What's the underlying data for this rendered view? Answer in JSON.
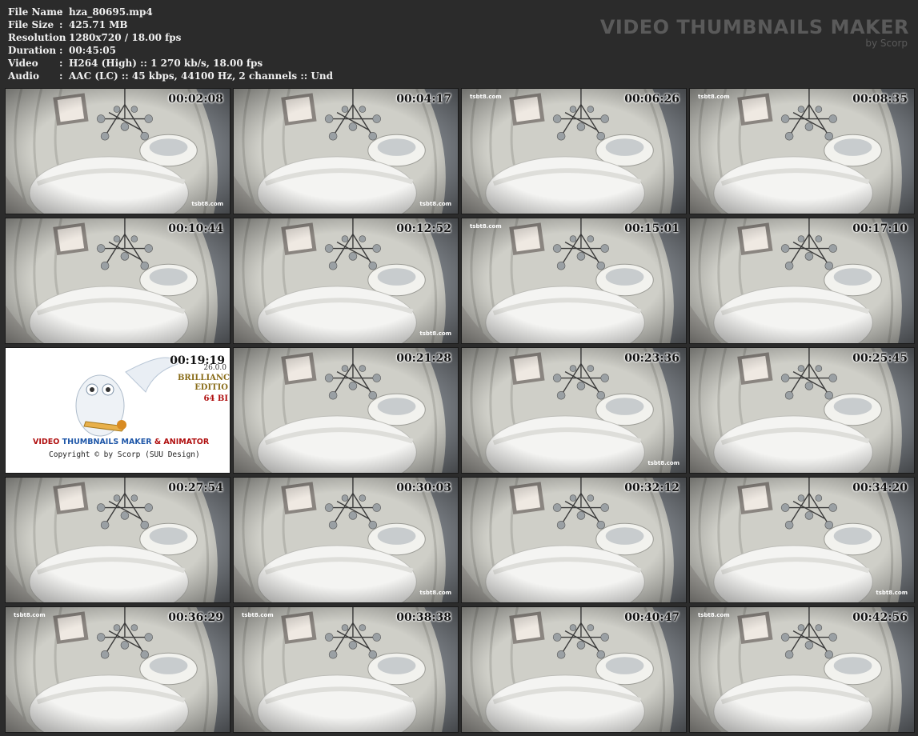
{
  "file_info": [
    {
      "key": "File Name",
      "value": "hza_80695.mp4"
    },
    {
      "key": "File Size",
      "value": "425.71 MB"
    },
    {
      "key": "Resolution",
      "value": "1280x720 / 18.00 fps"
    },
    {
      "key": "Duration",
      "value": "00:45:05"
    },
    {
      "key": "Video",
      "value": "H264 (High) :: 1 270 kb/s, 18.00 fps"
    },
    {
      "key": "Audio",
      "value": "AAC (LC) :: 45 kbps, 44100 Hz, 2 channels :: Und"
    }
  ],
  "brand": {
    "title": "VIDEO THUMBNAILS MAKER",
    "subtitle": "by Scorp"
  },
  "watermark": "tsbt8.com",
  "thumbnails": [
    {
      "time": "00:02:08",
      "wm": "br"
    },
    {
      "time": "00:04:17",
      "wm": "br"
    },
    {
      "time": "00:06:26",
      "wm": "tl"
    },
    {
      "time": "00:08:35",
      "wm": "tl"
    },
    {
      "time": "00:10:44",
      "wm": "none"
    },
    {
      "time": "00:12:52",
      "wm": "br"
    },
    {
      "time": "00:15:01",
      "wm": "tl"
    },
    {
      "time": "00:17:10",
      "wm": "none"
    },
    {
      "time": "00:19:19",
      "logo": true
    },
    {
      "time": "00:21:28",
      "wm": "none"
    },
    {
      "time": "00:23:36",
      "wm": "br"
    },
    {
      "time": "00:25:45",
      "wm": "none"
    },
    {
      "time": "00:27:54",
      "wm": "none"
    },
    {
      "time": "00:30:03",
      "wm": "br"
    },
    {
      "time": "00:32:12",
      "wm": "none"
    },
    {
      "time": "00:34:20",
      "wm": "br"
    },
    {
      "time": "00:36:29",
      "wm": "tl"
    },
    {
      "time": "00:38:38",
      "wm": "tl"
    },
    {
      "time": "00:40:47",
      "wm": "none"
    },
    {
      "time": "00:42:56",
      "wm": "tl"
    }
  ],
  "logo_tile": {
    "date": "26.0.0",
    "edition_line1": "BRILLIANC",
    "edition_line2": "EDITIO",
    "edition_line3": "64 BI",
    "title_part1": "VIDEO",
    "title_part2": "THUMBNAILS MAKER",
    "title_part3": "& ANIMATOR",
    "copyright": "Copyright © by Scorp (SUU Design)"
  },
  "colors": {
    "background": "#2b2b2b",
    "header_text": "#f0f0f0",
    "brand_text": "#5a5a5a"
  }
}
